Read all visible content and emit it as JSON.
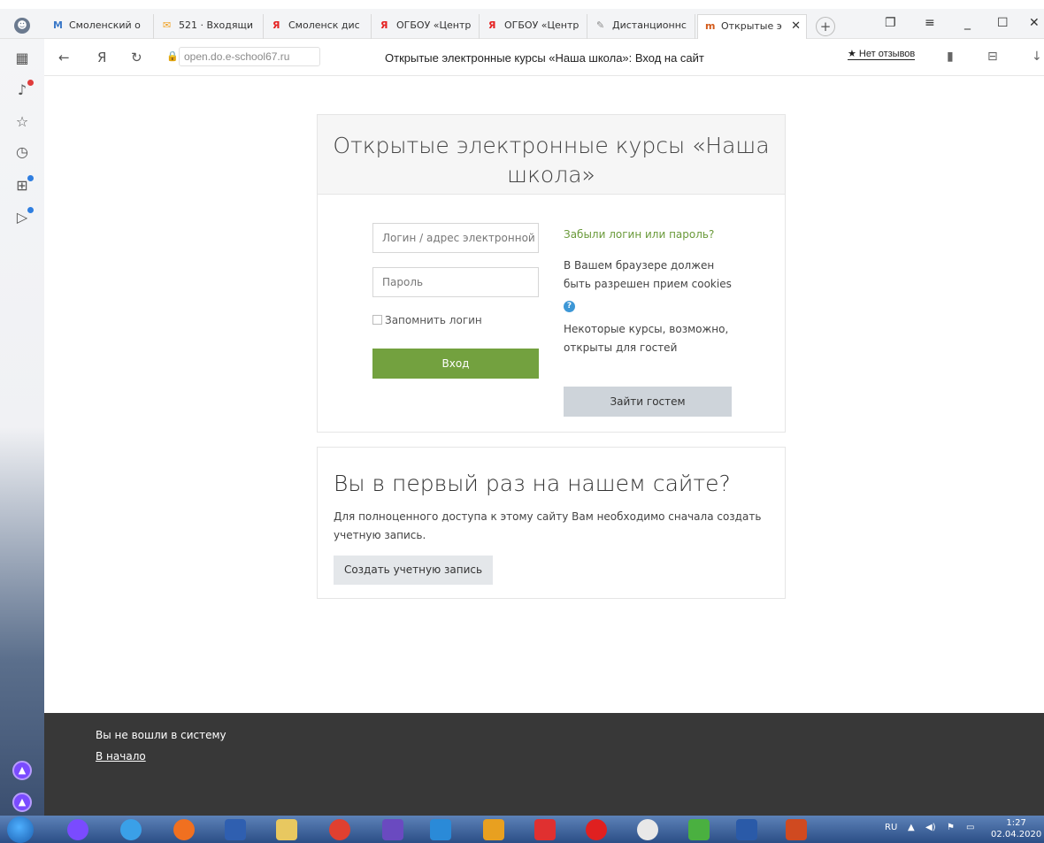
{
  "browser": {
    "tabs": [
      {
        "icon": "M",
        "label": "Смоленский о"
      },
      {
        "icon": "✉",
        "label": "521 · Входящи"
      },
      {
        "icon": "Я",
        "label": "Смоленск дис"
      },
      {
        "icon": "Я",
        "label": "ОГБОУ «Центр"
      },
      {
        "icon": "Я",
        "label": "ОГБОУ «Центр"
      },
      {
        "icon": "✎",
        "label": "Дистанционнс"
      },
      {
        "icon": "m",
        "label": "Открытые э"
      }
    ],
    "address": {
      "domain": "open.do.e-school67.ru",
      "page_title": "Открытые электронные курсы «Наша школа»: Вход на сайт",
      "reviews": "★ Нет отзывов"
    }
  },
  "login": {
    "heading": "Открытые электронные курсы «Наша школа»",
    "username_placeholder": "Логин / адрес электронной почты",
    "password_placeholder": "Пароль",
    "remember_label": "Запомнить логин",
    "login_button": "Вход",
    "forgot_link": "Забыли логин или пароль?",
    "cookies_text": "В Вашем браузере должен быть разрешен прием cookies",
    "guest_info": "Некоторые курсы, возможно, открыты для гостей",
    "guest_button": "Зайти гостем"
  },
  "signup": {
    "title": "Вы в первый раз на нашем сайте?",
    "text": "Для полноценного доступа к этому сайту Вам необходимо сначала создать учетную запись.",
    "button": "Создать учетную запись"
  },
  "footer": {
    "not_logged": "Вы не вошли в систему",
    "home_link": "В начало"
  },
  "taskbar": {
    "language": "RU",
    "time": "1:27",
    "date": "02.04.2020"
  }
}
